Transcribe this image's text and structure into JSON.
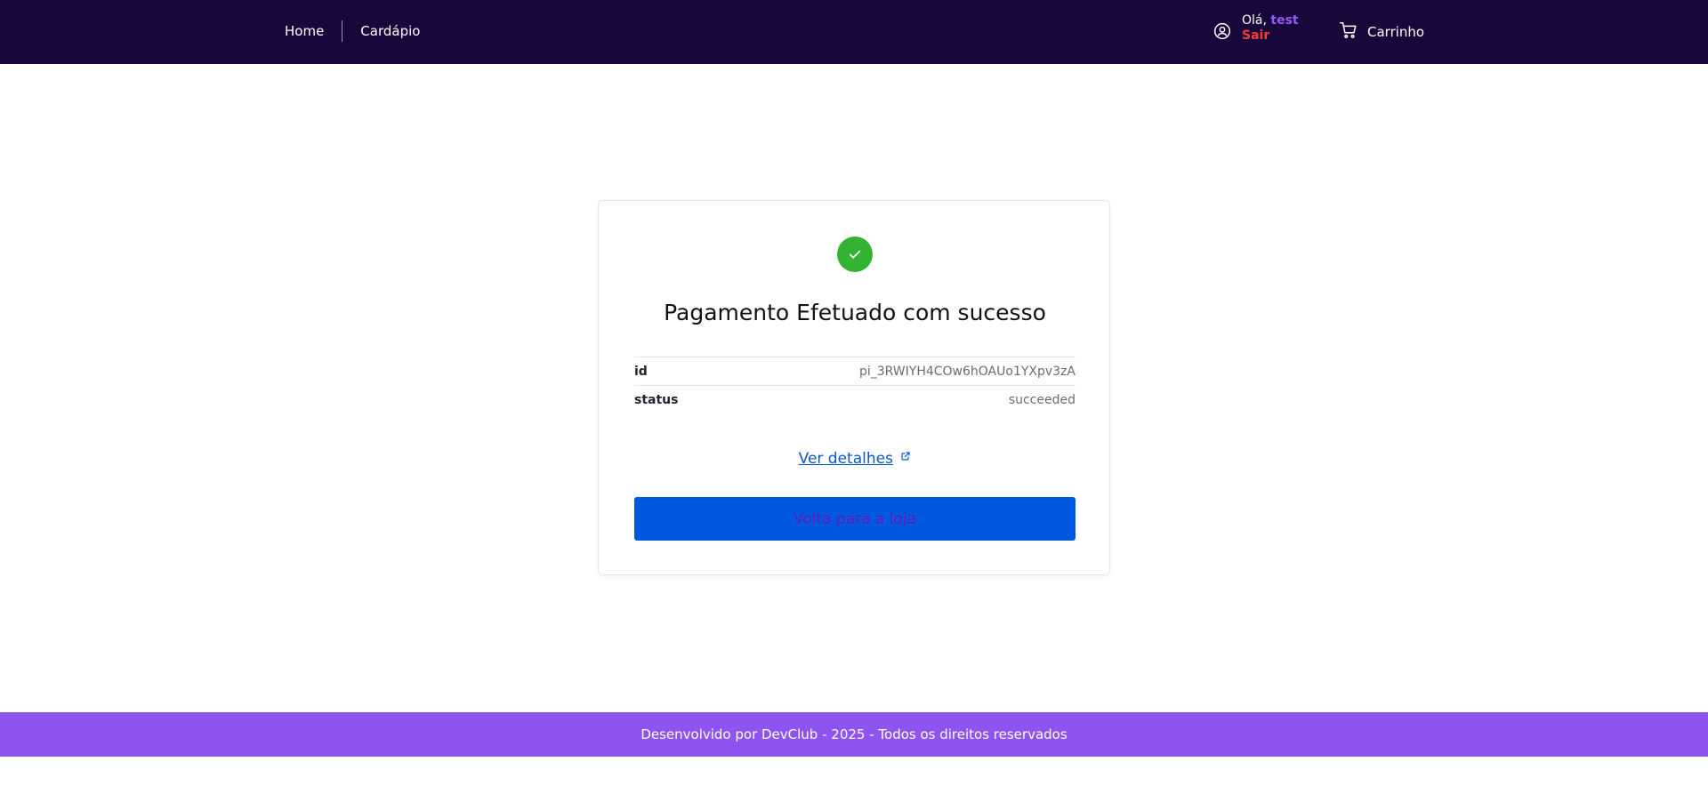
{
  "header": {
    "nav": [
      {
        "label": "Home"
      },
      {
        "label": "Cardápio"
      }
    ],
    "user": {
      "greeting": "Olá,",
      "name": "test",
      "logout_label": "Sair"
    },
    "cart_label": "Carrinho",
    "icons": {
      "user": "user-circle-icon",
      "cart": "shopping-cart-icon"
    }
  },
  "card": {
    "icon": "check-icon",
    "title": "Pagamento Efetuado com sucesso",
    "details": [
      {
        "key": "id",
        "value": "pi_3RWIYH4COw6hOAUo1YXpv3zA"
      },
      {
        "key": "status",
        "value": "succeeded"
      }
    ],
    "details_link_label": "Ver detalhes",
    "back_button_label": "Volta para a loja"
  },
  "footer": {
    "text": "Desenvolvido por DevClub - 2025 - Todos os direitos reservados"
  },
  "colors": {
    "header_bg": "#17073a",
    "footer_bg": "#8f53ef",
    "success": "#32b332",
    "primary_button": "#0057e0",
    "username": "#9758ff",
    "logout": "#ff3b30"
  }
}
